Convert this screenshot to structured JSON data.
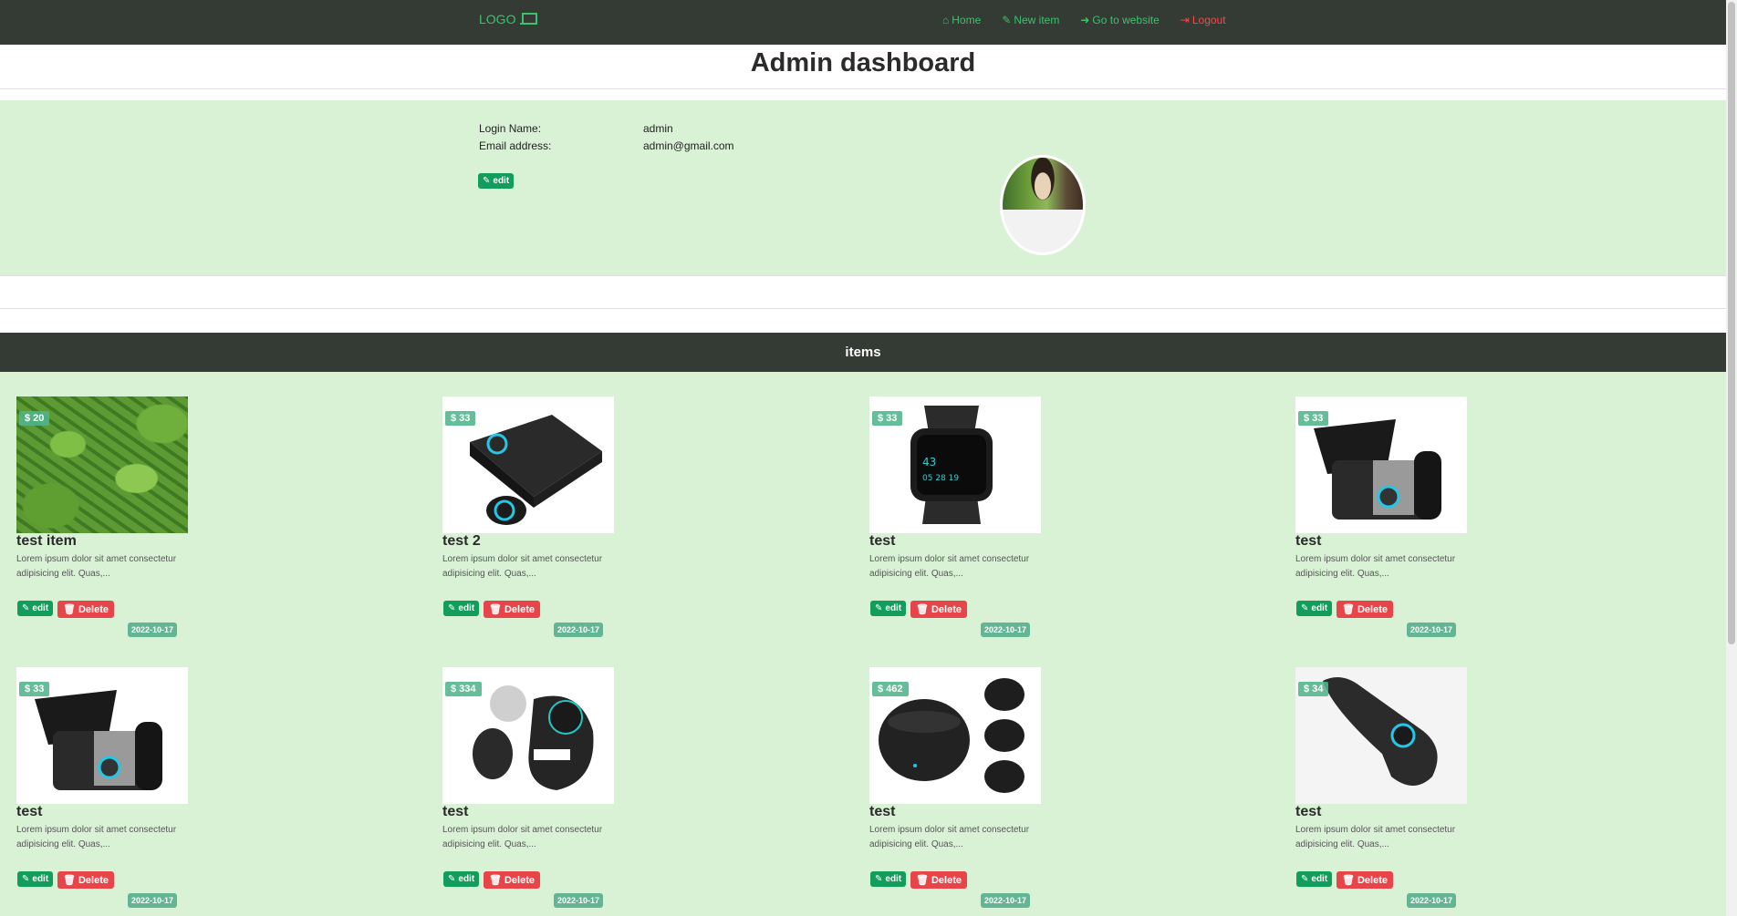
{
  "navbar": {
    "logo": "LOGO",
    "items": [
      {
        "label": "Home",
        "icon": "home-icon"
      },
      {
        "label": "New item",
        "icon": "pencil-icon"
      },
      {
        "label": "Go to website",
        "icon": "arrow-circle-icon"
      },
      {
        "label": "Logout",
        "icon": "sign-out-icon"
      }
    ]
  },
  "page_title": "Admin dashboard",
  "profile": {
    "login_label": "Login Name:",
    "login_value": "admin",
    "email_label": "Email address:",
    "email_value": "admin@gmail.com",
    "edit_label": "edit"
  },
  "items_header": "items",
  "card_labels": {
    "edit": "edit",
    "delete": "Delete"
  },
  "items": [
    {
      "price": "$ 20",
      "title": "test item",
      "desc": "Lorem ipsum dolor sit amet consectetur adipisicing elit. Quas,...",
      "date": "2022-10-17",
      "image": "cannabis-leaves"
    },
    {
      "price": "$ 33",
      "title": "test 2",
      "desc": "Lorem ipsum dolor sit amet consectetur adipisicing elit. Quas,...",
      "date": "2022-10-17",
      "image": "earbuds-case"
    },
    {
      "price": "$ 33",
      "title": "test",
      "desc": "Lorem ipsum dolor sit amet consectetur adipisicing elit. Quas,...",
      "date": "2022-10-17",
      "image": "smartwatch"
    },
    {
      "price": "$ 33",
      "title": "test",
      "desc": "Lorem ipsum dolor sit amet consectetur adipisicing elit. Quas,...",
      "date": "2022-10-17",
      "image": "kitchen-robot"
    },
    {
      "price": "$ 33",
      "title": "test",
      "desc": "Lorem ipsum dolor sit amet consectetur adipisicing elit. Quas,...",
      "date": "2022-10-17",
      "image": "kitchen-robot"
    },
    {
      "price": "$ 334",
      "title": "test",
      "desc": "Lorem ipsum dolor sit amet consectetur adipisicing elit. Quas,...",
      "date": "2022-10-17",
      "image": "tracker-device"
    },
    {
      "price": "$ 462",
      "title": "test",
      "desc": "Lorem ipsum dolor sit amet consectetur adipisicing elit. Quas,...",
      "date": "2022-10-17",
      "image": "speaker-devices"
    },
    {
      "price": "$ 34",
      "title": "test",
      "desc": "Lorem ipsum dolor sit amet consectetur adipisicing elit. Quas,...",
      "date": "2022-10-17",
      "image": "handheld-device"
    }
  ],
  "colors": {
    "navbar": "#343a34",
    "accent": "#3ec16d",
    "background": "#d9f2d6",
    "edit": "#139d5c",
    "delete": "#e8454a",
    "logout": "#f24b4b"
  }
}
